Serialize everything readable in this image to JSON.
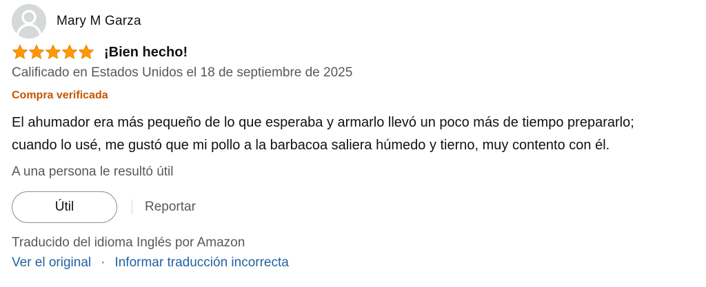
{
  "reviewer": {
    "name": "Mary M Garza",
    "avatar_icon": "user-avatar-icon"
  },
  "rating": {
    "stars": 5,
    "max_stars": 5,
    "star_color": "#ff9900"
  },
  "review": {
    "title": "¡Bien hecho!",
    "date_line": "Calificado en Estados Unidos el 18 de septiembre de 2025",
    "verified_label": "Compra verificada",
    "body_line_1": "El ahumador era más pequeño de lo que esperaba y armarlo llevó un poco más de tiempo prepararlo;",
    "body_line_2": "cuando lo usé, me gustó que mi pollo a la barbacoa saliera húmedo y tierno, muy contento con él."
  },
  "helpful": {
    "count_text": "A una persona le resultó útil",
    "button_label": "Útil",
    "report_label": "Reportar"
  },
  "translation": {
    "note": "Traducido del idioma Inglés por Amazon",
    "view_original": "Ver el original",
    "separator": "·",
    "report_translation": "Informar traducción incorrecta"
  },
  "colors": {
    "verified": "#c45500",
    "link": "#2162a1",
    "muted": "#565959"
  }
}
